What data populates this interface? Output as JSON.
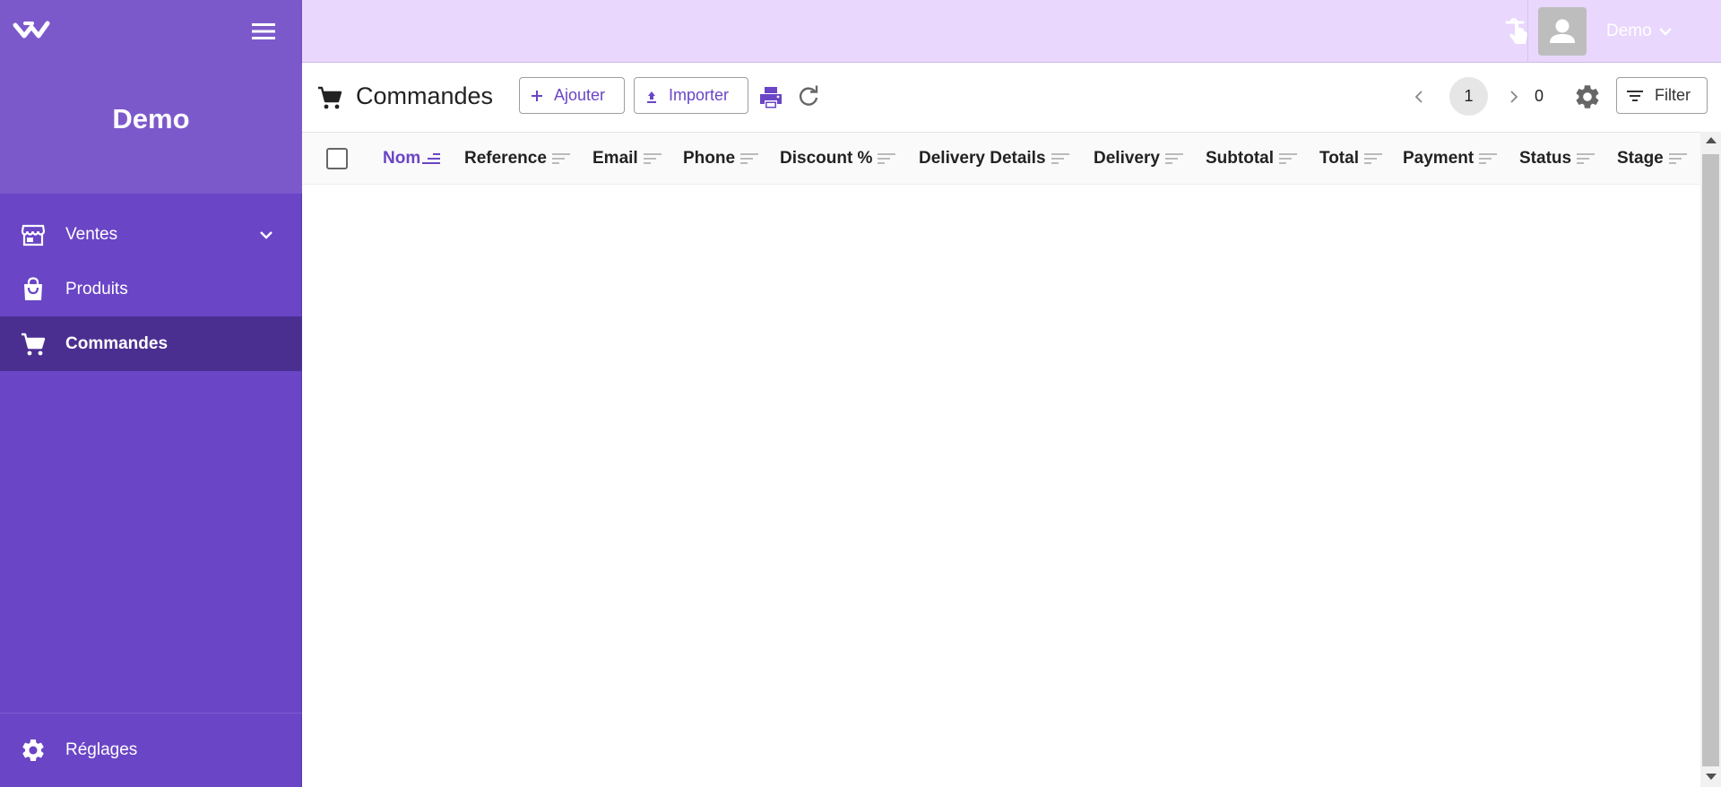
{
  "sidebar": {
    "title": "Demo",
    "items": [
      {
        "label": "Ventes",
        "icon": "storefront-icon",
        "expandable": true
      },
      {
        "label": "Produits",
        "icon": "shopping-bag-icon"
      },
      {
        "label": "Commandes",
        "icon": "cart-icon",
        "active": true
      }
    ],
    "settings": {
      "label": "Réglages",
      "icon": "gear-icon"
    }
  },
  "topbar": {
    "user": "Demo"
  },
  "toolbar": {
    "title": "Commandes",
    "add_label": "Ajouter",
    "import_label": "Importer",
    "filter_label": "Filter",
    "page": "1",
    "total": "0"
  },
  "table": {
    "columns": [
      "Nom",
      "Reference",
      "Email",
      "Phone",
      "Discount %",
      "Delivery Details",
      "Delivery",
      "Subtotal",
      "Total",
      "Payment",
      "Status",
      "Stage"
    ],
    "sorted_column": "Nom",
    "rows": []
  },
  "colors": {
    "brand": "#6a45c6",
    "sidebar_header": "#7c59cb",
    "active_item": "#4b2f90",
    "topbar": "#e9d7fd"
  }
}
